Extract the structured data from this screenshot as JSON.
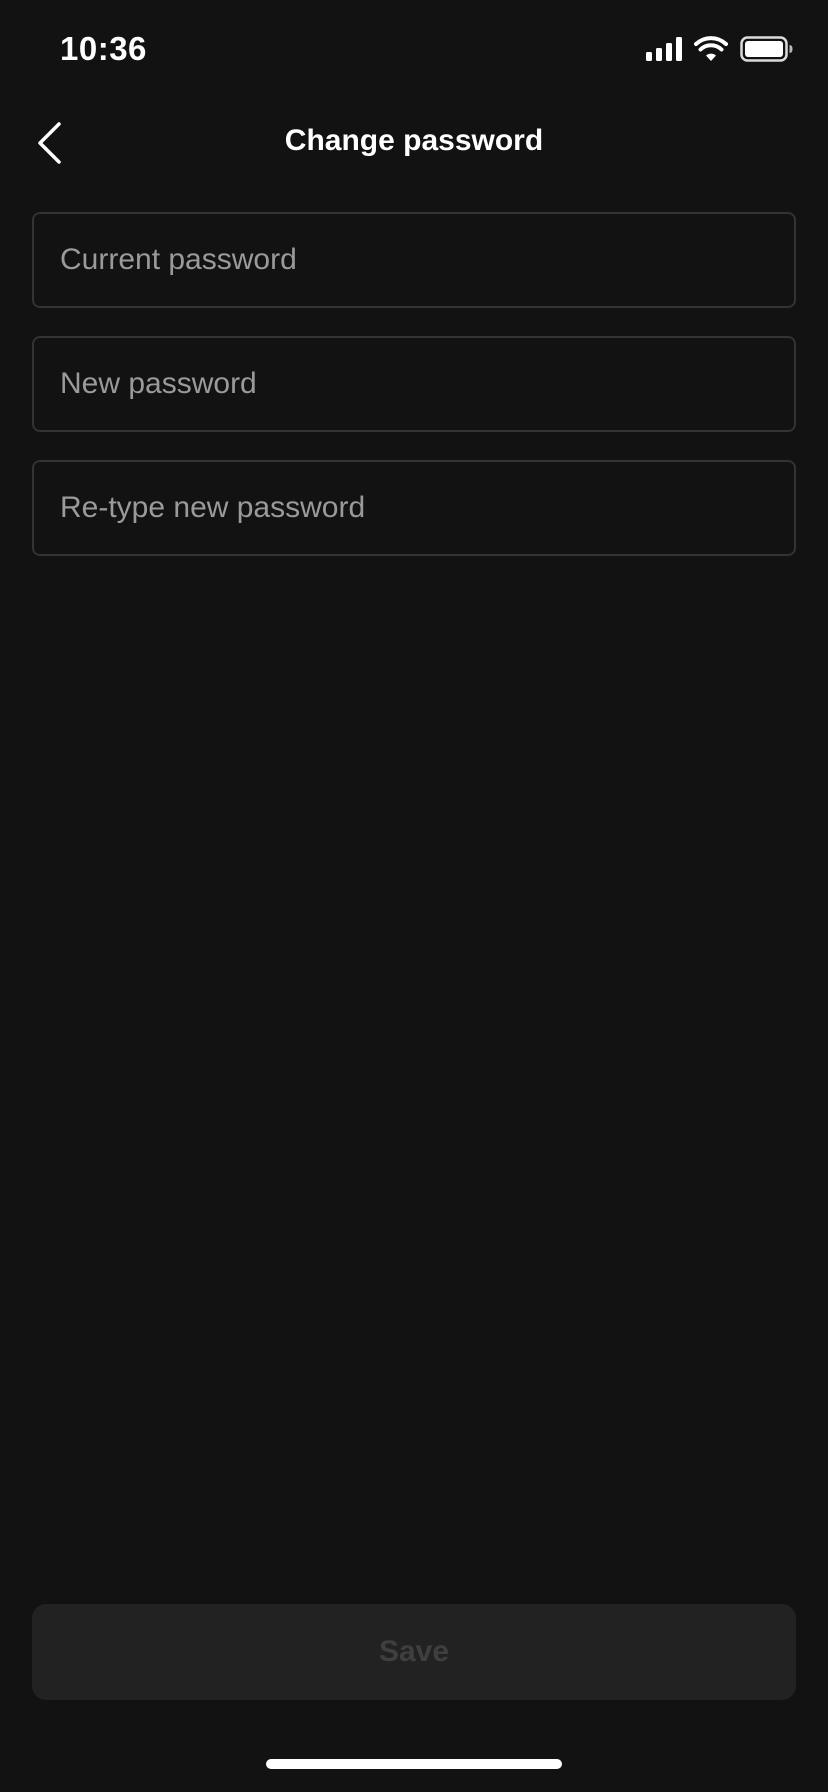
{
  "status_bar": {
    "time": "10:36",
    "icons": [
      "cellular-signal-icon",
      "wifi-icon",
      "battery-icon"
    ]
  },
  "nav": {
    "back_icon": "chevron-left-icon",
    "title": "Change password"
  },
  "form": {
    "current_password": {
      "placeholder": "Current password",
      "value": ""
    },
    "new_password": {
      "placeholder": "New password",
      "value": ""
    },
    "retype_password": {
      "placeholder": "Re-type new password",
      "value": ""
    }
  },
  "actions": {
    "save_label": "Save",
    "save_enabled": false
  },
  "colors": {
    "background": "#121212",
    "field_border": "#333333",
    "placeholder": "#9a9a9a",
    "button_disabled_bg": "#222222",
    "button_disabled_text": "#3f3f3f"
  }
}
